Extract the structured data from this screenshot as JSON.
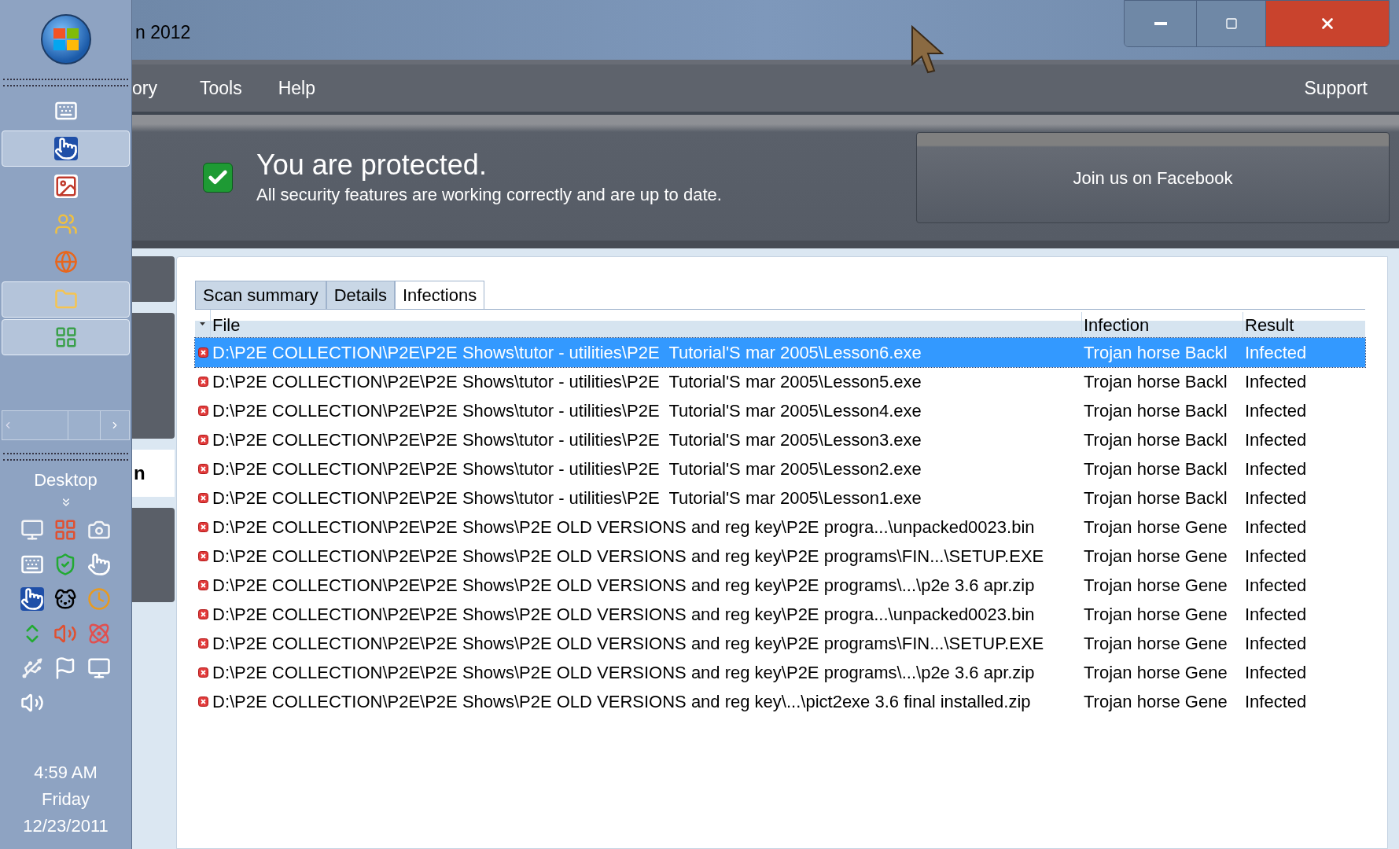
{
  "window": {
    "title": "n 2012"
  },
  "menu": [
    "ory",
    "Tools",
    "Help"
  ],
  "menu_right": "Support",
  "status": {
    "headline": "You are protected.",
    "detail": "All security features are working correctly and are up to date.",
    "protected": true
  },
  "facebook_button": "Join us on Facebook",
  "side_label": "n",
  "taskbar": {
    "pinned": [
      {
        "active": false
      },
      {
        "active": true
      },
      {
        "active": false
      },
      {
        "active": false
      },
      {
        "active": false
      },
      {
        "active": true
      },
      {
        "active": true
      }
    ],
    "desktop_label": "Desktop",
    "time": "4:59 AM",
    "day": "Friday",
    "date": "12/23/2011"
  },
  "tabs": [
    {
      "label": "Scan summary",
      "selected": false
    },
    {
      "label": "Details",
      "selected": false
    },
    {
      "label": "Infections",
      "selected": true
    }
  ],
  "table": {
    "columns": [
      "File",
      "Infection",
      "Result"
    ],
    "rows": [
      {
        "file": "D:\\P2E COLLECTION\\P2E\\P2E Shows\\tutor - utilities\\P2E  Tutorial'S mar 2005\\Lesson6.exe",
        "infection": "Trojan horse Backl",
        "result": "Infected",
        "selected": true
      },
      {
        "file": "D:\\P2E COLLECTION\\P2E\\P2E Shows\\tutor - utilities\\P2E  Tutorial'S mar 2005\\Lesson5.exe",
        "infection": "Trojan horse Backl",
        "result": "Infected",
        "selected": false
      },
      {
        "file": "D:\\P2E COLLECTION\\P2E\\P2E Shows\\tutor - utilities\\P2E  Tutorial'S mar 2005\\Lesson4.exe",
        "infection": "Trojan horse Backl",
        "result": "Infected",
        "selected": false
      },
      {
        "file": "D:\\P2E COLLECTION\\P2E\\P2E Shows\\tutor - utilities\\P2E  Tutorial'S mar 2005\\Lesson3.exe",
        "infection": "Trojan horse Backl",
        "result": "Infected",
        "selected": false
      },
      {
        "file": "D:\\P2E COLLECTION\\P2E\\P2E Shows\\tutor - utilities\\P2E  Tutorial'S mar 2005\\Lesson2.exe",
        "infection": "Trojan horse Backl",
        "result": "Infected",
        "selected": false
      },
      {
        "file": "D:\\P2E COLLECTION\\P2E\\P2E Shows\\tutor - utilities\\P2E  Tutorial'S mar 2005\\Lesson1.exe",
        "infection": "Trojan horse Backl",
        "result": "Infected",
        "selected": false
      },
      {
        "file": "D:\\P2E COLLECTION\\P2E\\P2E Shows\\P2E OLD VERSIONS and reg key\\P2E progra...\\unpacked0023.bin",
        "infection": "Trojan horse Gene",
        "result": "Infected",
        "selected": false
      },
      {
        "file": "D:\\P2E COLLECTION\\P2E\\P2E Shows\\P2E OLD VERSIONS and reg key\\P2E programs\\FIN...\\SETUP.EXE",
        "infection": "Trojan horse Gene",
        "result": "Infected",
        "selected": false
      },
      {
        "file": "D:\\P2E COLLECTION\\P2E\\P2E Shows\\P2E OLD VERSIONS and reg key\\P2E programs\\...\\p2e 3.6 apr.zip",
        "infection": "Trojan horse Gene",
        "result": "Infected",
        "selected": false
      },
      {
        "file": "D:\\P2E COLLECTION\\P2E\\P2E Shows\\P2E OLD VERSIONS and reg key\\P2E progra...\\unpacked0023.bin",
        "infection": "Trojan horse Gene",
        "result": "Infected",
        "selected": false
      },
      {
        "file": "D:\\P2E COLLECTION\\P2E\\P2E Shows\\P2E OLD VERSIONS and reg key\\P2E programs\\FIN...\\SETUP.EXE",
        "infection": "Trojan horse Gene",
        "result": "Infected",
        "selected": false
      },
      {
        "file": "D:\\P2E COLLECTION\\P2E\\P2E Shows\\P2E OLD VERSIONS and reg key\\P2E programs\\...\\p2e 3.6 apr.zip",
        "infection": "Trojan horse Gene",
        "result": "Infected",
        "selected": false
      },
      {
        "file": "D:\\P2E COLLECTION\\P2E\\P2E Shows\\P2E OLD VERSIONS and reg key\\...\\pict2exe 3.6 final installed.zip",
        "infection": "Trojan horse Gene",
        "result": "Infected",
        "selected": false
      }
    ]
  }
}
